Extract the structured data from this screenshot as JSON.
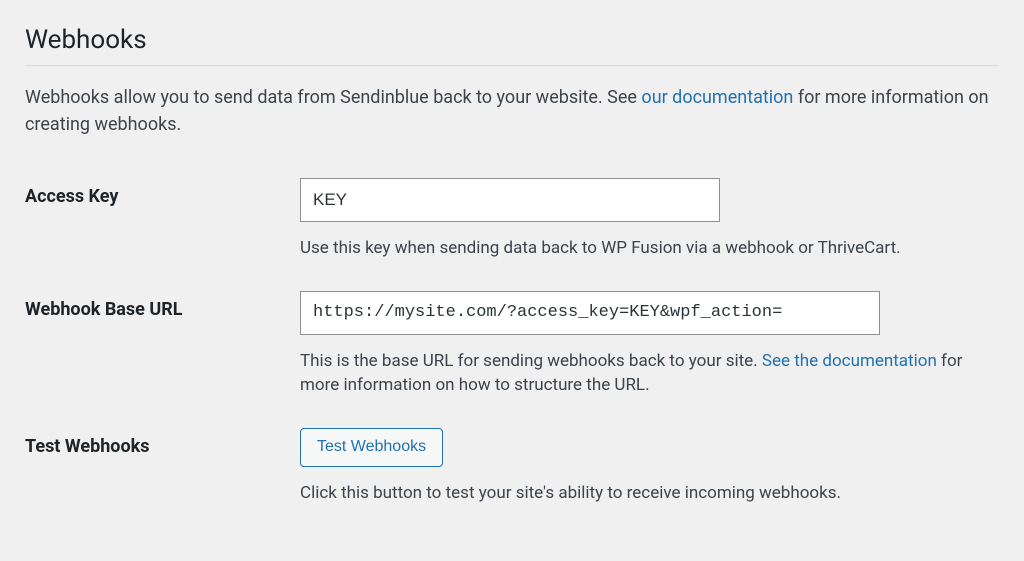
{
  "section": {
    "title": "Webhooks",
    "description_before": "Webhooks allow you to send data from Sendinblue back to your website. See ",
    "description_link": "our documentation",
    "description_after": " for more information on creating webhooks."
  },
  "fields": {
    "access_key": {
      "label": "Access Key",
      "value": "KEY",
      "help": "Use this key when sending data back to WP Fusion via a webhook or ThriveCart."
    },
    "webhook_url": {
      "label": "Webhook Base URL",
      "value": "https://mysite.com/?access_key=KEY&wpf_action=",
      "help_before": "This is the base URL for sending webhooks back to your site. ",
      "help_link": "See the documentation",
      "help_after": " for more information on how to structure the URL."
    },
    "test": {
      "label": "Test Webhooks",
      "button": "Test Webhooks",
      "help": "Click this button to test your site's ability to receive incoming webhooks."
    }
  }
}
